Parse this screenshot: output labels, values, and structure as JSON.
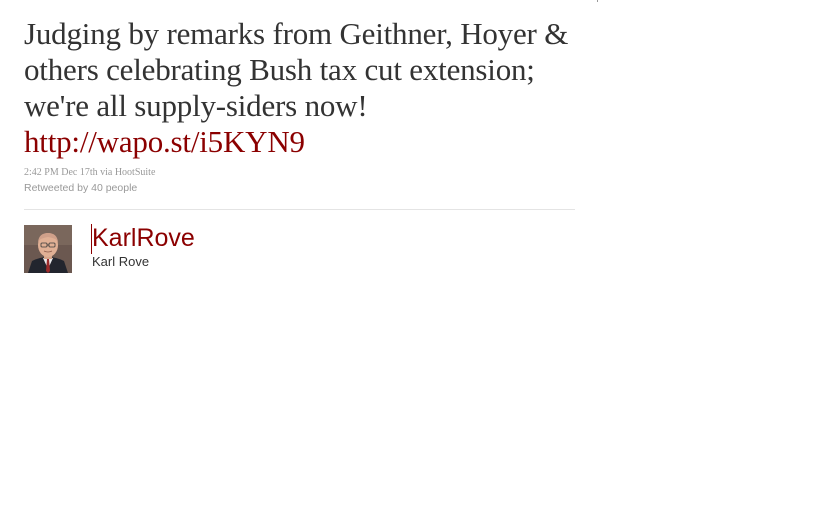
{
  "tweet": {
    "text": "Judging by remarks from Geithner, Hoyer & others celebrating Bush tax cut extension; we're all supply-siders now!",
    "link": "http://wapo.st/i5KYN9",
    "meta": "2:42 PM Dec 17th via HootSuite",
    "retweets": "Retweeted by 40 people"
  },
  "author": {
    "screen_name": "KarlRove",
    "full_name": "Karl Rove",
    "avatar_icon": "profile-photo-icon"
  },
  "colors": {
    "link": "#8b0000",
    "text": "#333333",
    "muted": "#999999",
    "divider": "#e4e4e4"
  }
}
